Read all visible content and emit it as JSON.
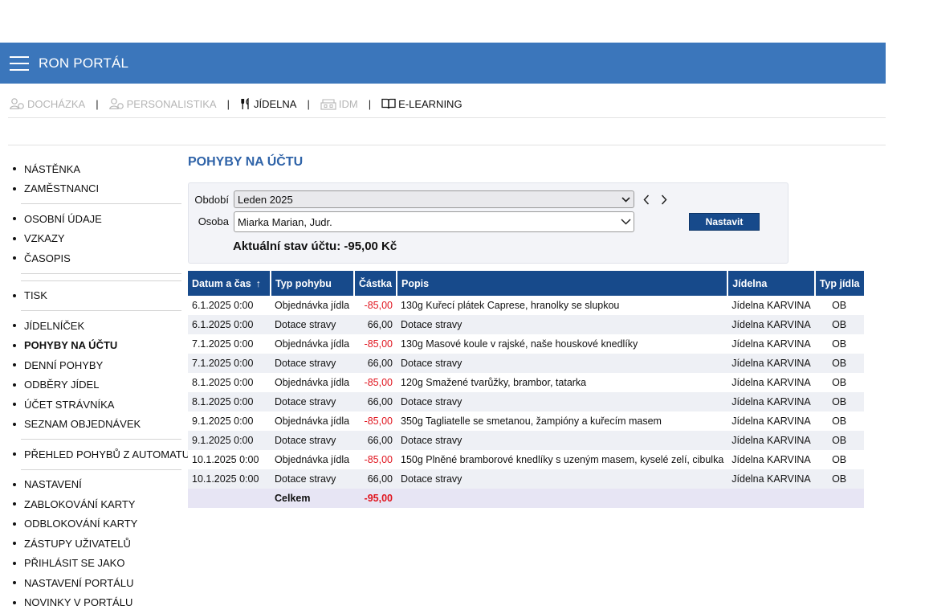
{
  "header": {
    "title": "RON PORTÁL"
  },
  "topnav": [
    {
      "label": "DOCHÁZKA",
      "icon": "person-icon",
      "state": "disabled"
    },
    {
      "label": "PERSONALISTIKA",
      "icon": "person-icon",
      "state": "disabled"
    },
    {
      "label": "JÍDELNA",
      "icon": "cutlery-icon",
      "state": "active"
    },
    {
      "label": "IDM",
      "icon": "building-icon",
      "state": "disabled"
    },
    {
      "label": "E-LEARNING",
      "icon": "book-icon",
      "state": "active"
    }
  ],
  "sidebar": {
    "groups": [
      [
        "NÁSTĚNKA",
        "ZAMĚSTNANCI"
      ],
      [
        "OSOBNÍ ÚDAJE",
        "VZKAZY",
        "ČASOPIS"
      ],
      [
        "TISK"
      ],
      [
        "JÍDELNÍČEK",
        "POHYBY NA ÚČTU",
        "DENNÍ POHYBY",
        "ODBĚRY JÍDEL",
        "ÚČET STRÁVNÍKA",
        "SEZNAM OBJEDNÁVEK"
      ],
      [
        "PŘEHLED POHYBŮ Z AUTOMATU"
      ],
      [
        "NASTAVENÍ",
        "ZABLOKOVÁNÍ KARTY",
        "ODBLOKOVÁNÍ KARTY",
        "ZÁSTUPY UŽIVATELŮ",
        "PŘIHLÁSIT SE JAKO",
        "NASTAVENÍ PORTÁLU",
        "NOVINKY V PORTÁLU"
      ]
    ],
    "active": "POHYBY NA ÚČTU"
  },
  "page": {
    "title": "POHYBY NA ÚČTU"
  },
  "filter": {
    "period_label": "Období",
    "period_value": "Leden 2025",
    "person_label": "Osoba",
    "person_value": "Miarka Marian, Judr.",
    "button_label": "Nastavit",
    "balance_text": "Aktuální stav účtu: -95,00 Kč"
  },
  "table": {
    "headers": [
      "Datum a čas",
      "Typ pohybu",
      "Částka",
      "Popis",
      "Jídelna",
      "Typ jídla"
    ],
    "sort_indicator": "↑",
    "rows": [
      [
        "6.1.2025 0:00",
        "Objednávka jídla",
        "-85,00",
        "130g Kuřecí plátek Caprese, hranolky se slupkou",
        "Jídelna KARVINA",
        "OB"
      ],
      [
        "6.1.2025 0:00",
        "Dotace stravy",
        "66,00",
        "Dotace stravy",
        "Jídelna KARVINA",
        "OB"
      ],
      [
        "7.1.2025 0:00",
        "Objednávka jídla",
        "-85,00",
        "130g Masové koule v rajské, naše houskové knedlíky",
        "Jídelna KARVINA",
        "OB"
      ],
      [
        "7.1.2025 0:00",
        "Dotace stravy",
        "66,00",
        "Dotace stravy",
        "Jídelna KARVINA",
        "OB"
      ],
      [
        "8.1.2025 0:00",
        "Objednávka jídla",
        "-85,00",
        "120g Smažené tvarůžky, brambor, tatarka",
        "Jídelna KARVINA",
        "OB"
      ],
      [
        "8.1.2025 0:00",
        "Dotace stravy",
        "66,00",
        "Dotace stravy",
        "Jídelna KARVINA",
        "OB"
      ],
      [
        "9.1.2025 0:00",
        "Objednávka jídla",
        "-85,00",
        "350g Tagliatelle se smetanou, žampióny a kuřecím masem",
        "Jídelna KARVINA",
        "OB"
      ],
      [
        "9.1.2025 0:00",
        "Dotace stravy",
        "66,00",
        "Dotace stravy",
        "Jídelna KARVINA",
        "OB"
      ],
      [
        "10.1.2025 0:00",
        "Objednávka jídla",
        "-85,00",
        "150g Plněné bramborové knedlíky s uzeným masem, kyselé zelí, cibulka",
        "Jídelna KARVINA",
        "OB"
      ],
      [
        "10.1.2025 0:00",
        "Dotace stravy",
        "66,00",
        "Dotace stravy",
        "Jídelna KARVINA",
        "OB"
      ]
    ],
    "total_label": "Celkem",
    "total_value": "-95,00"
  },
  "colors": {
    "header_bg": "#3b76bb",
    "table_header_bg": "#174a8b",
    "page_title": "#2f63a8",
    "negative": "#e0141e"
  }
}
